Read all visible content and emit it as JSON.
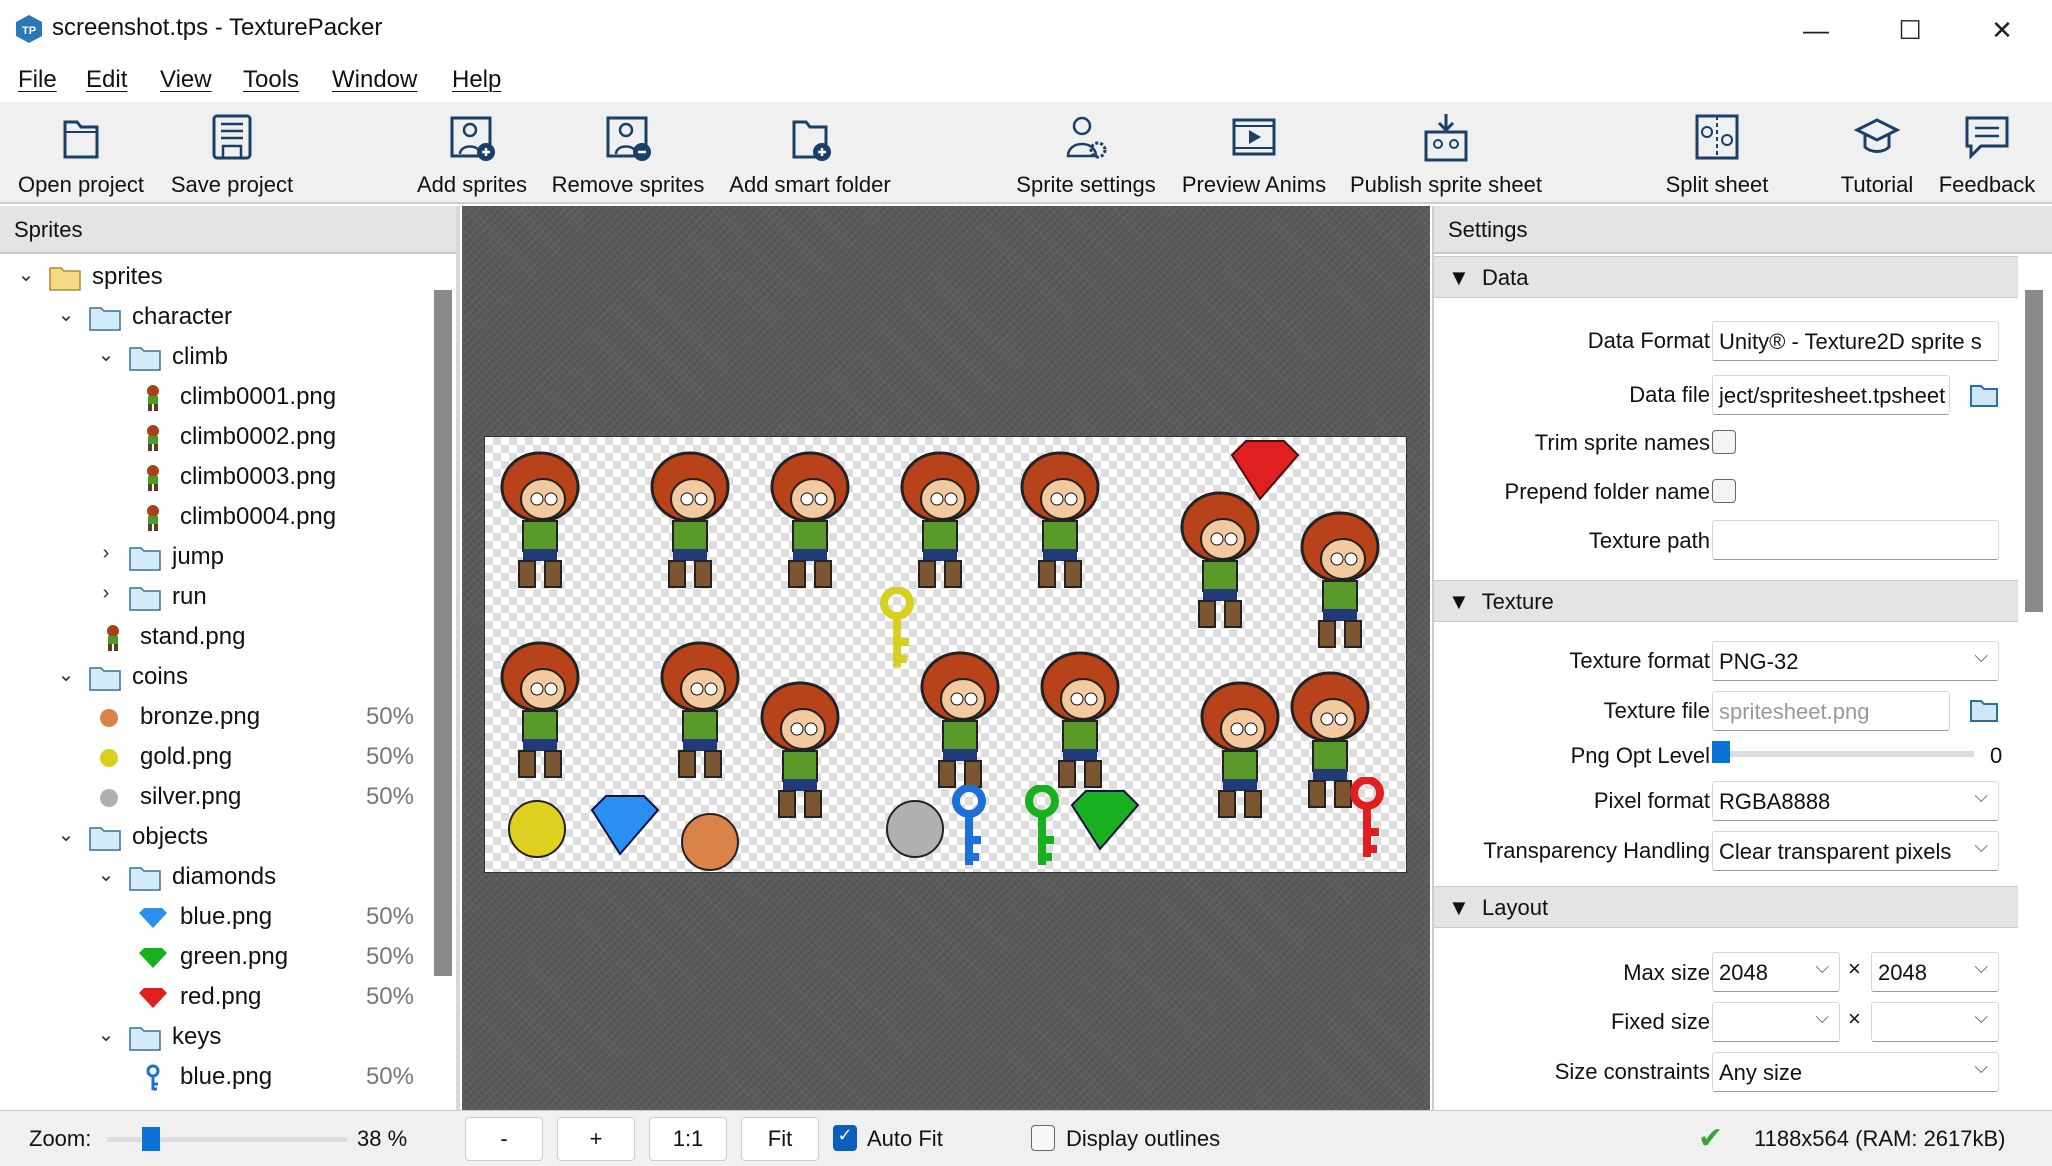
{
  "window": {
    "title": "screenshot.tps - TexturePacker",
    "minimize": "—",
    "maximize": "☐",
    "close": "✕"
  },
  "menu": [
    "File",
    "Edit",
    "View",
    "Tools",
    "Window",
    "Help"
  ],
  "toolbar": [
    {
      "label": "Open project",
      "icon": "folder-open-icon"
    },
    {
      "label": "Save project",
      "icon": "save-icon"
    },
    {
      "label": "Add sprites",
      "icon": "add-sprite-icon"
    },
    {
      "label": "Remove sprites",
      "icon": "remove-sprite-icon"
    },
    {
      "label": "Add smart folder",
      "icon": "add-folder-icon"
    },
    {
      "label": "Sprite settings",
      "icon": "sprite-settings-icon"
    },
    {
      "label": "Preview Anims",
      "icon": "film-play-icon"
    },
    {
      "label": "Publish sprite sheet",
      "icon": "publish-icon"
    },
    {
      "label": "Split sheet",
      "icon": "split-sheet-icon"
    },
    {
      "label": "Tutorial",
      "icon": "graduation-cap-icon"
    },
    {
      "label": "Feedback",
      "icon": "speech-bubble-icon"
    }
  ],
  "sprites_panel": {
    "title": "Sprites",
    "tree": [
      {
        "level": 0,
        "type": "root",
        "exp": "open",
        "name": "sprites"
      },
      {
        "level": 1,
        "type": "folder",
        "exp": "open",
        "name": "character"
      },
      {
        "level": 2,
        "type": "folder",
        "exp": "open",
        "name": "climb"
      },
      {
        "level": 3,
        "type": "char",
        "name": "climb0001.png"
      },
      {
        "level": 3,
        "type": "char",
        "name": "climb0002.png"
      },
      {
        "level": 3,
        "type": "char",
        "name": "climb0003.png"
      },
      {
        "level": 3,
        "type": "char",
        "name": "climb0004.png"
      },
      {
        "level": 2,
        "type": "folder",
        "exp": "closed",
        "name": "jump"
      },
      {
        "level": 2,
        "type": "folder",
        "exp": "closed",
        "name": "run"
      },
      {
        "level": 2,
        "type": "char",
        "name": "stand.png"
      },
      {
        "level": 1,
        "type": "folder",
        "exp": "open",
        "name": "coins"
      },
      {
        "level": 2,
        "type": "coin",
        "color": "#d9824a",
        "name": "bronze.png",
        "pct": "50%"
      },
      {
        "level": 2,
        "type": "coin",
        "color": "#d8d020",
        "name": "gold.png",
        "pct": "50%"
      },
      {
        "level": 2,
        "type": "coin",
        "color": "#b0b0b0",
        "name": "silver.png",
        "pct": "50%"
      },
      {
        "level": 1,
        "type": "folder",
        "exp": "open",
        "name": "objects"
      },
      {
        "level": 2,
        "type": "folder",
        "exp": "open",
        "name": "diamonds"
      },
      {
        "level": 3,
        "type": "gem",
        "color": "#2a8ff0",
        "name": "blue.png",
        "pct": "50%"
      },
      {
        "level": 3,
        "type": "gem",
        "color": "#18b020",
        "name": "green.png",
        "pct": "50%"
      },
      {
        "level": 3,
        "type": "gem",
        "color": "#e02020",
        "name": "red.png",
        "pct": "50%"
      },
      {
        "level": 2,
        "type": "folder",
        "exp": "open",
        "name": "keys"
      },
      {
        "level": 3,
        "type": "key",
        "color": "#1e6fd8",
        "name": "blue.png",
        "pct": "50%"
      }
    ]
  },
  "settings": {
    "title": "Settings",
    "data": {
      "header": "Data",
      "data_format_label": "Data Format",
      "data_format": "Unity® - Texture2D sprite s",
      "data_file_label": "Data file",
      "data_file": "ject/spritesheet.tpsheet",
      "trim_label": "Trim sprite names",
      "trim": false,
      "prepend_label": "Prepend folder name",
      "prepend": false,
      "texture_path_label": "Texture path",
      "texture_path": ""
    },
    "texture": {
      "header": "Texture",
      "format_label": "Texture format",
      "format": "PNG-32",
      "file_label": "Texture file",
      "file_placeholder": "spritesheet.png",
      "png_opt_label": "Png Opt Level",
      "png_opt": "0",
      "pixel_label": "Pixel format",
      "pixel": "RGBA8888",
      "transp_label": "Transparency Handling",
      "transp": "Clear transparent pixels"
    },
    "layout": {
      "header": "Layout",
      "max_label": "Max size",
      "max_w": "2048",
      "max_h": "2048",
      "times": "×",
      "fixed_label": "Fixed size",
      "fixed_w": "",
      "fixed_h": "",
      "constraints_label": "Size constraints",
      "constraints": "Any size"
    }
  },
  "status": {
    "zoom_label": "Zoom:",
    "zoom_value": "38 %",
    "zoom_percent": 38,
    "minus": "-",
    "plus": "+",
    "one": "1:1",
    "fit": "Fit",
    "auto_fit": "Auto Fit",
    "auto_fit_checked": true,
    "outlines": "Display outlines",
    "outlines_checked": false,
    "info": "1188x564 (RAM: 2617kB)"
  },
  "colors": {
    "accent": "#0a74d6",
    "icon": "#1b3f66",
    "folder": "#cfe6f7"
  }
}
